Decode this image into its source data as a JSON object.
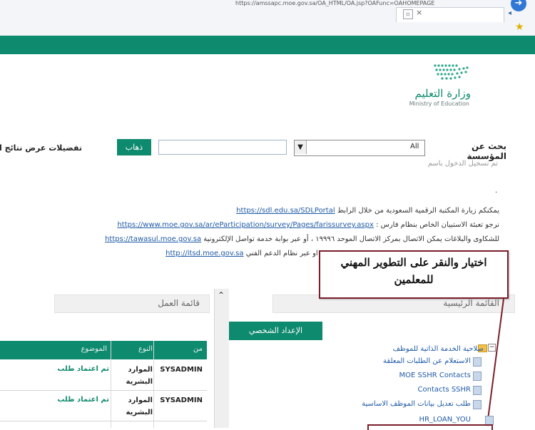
{
  "browser": {
    "url": "https://amssapc.moe.gov.sa/OA_HTML/OA.jsp?OAFunc=OAHOMEPAGE",
    "tab_close": "×"
  },
  "header": {
    "logo_arabic": "وزارة التعليم",
    "logo_english": "Ministry of Education"
  },
  "search": {
    "label": "بحث عن المؤسسة",
    "select_value": "All",
    "go_button": "ذهاب",
    "preferences_label": "تفضيلات عرض نتائج ا",
    "login_as": "تم تسجيل الدخول باسم"
  },
  "info": {
    "dot": ".",
    "line1_text": "يمكنكم زيارة المكتبة الرقمية السعودية من خلال الرابط",
    "line1_link": "https://sdl.edu.sa/SDLPortal",
    "line2_text": "نرجو تعبئة الاستبيان الخاص بنظام فارس :",
    "line2_link": "https://www.moe.gov.sa/ar/eParticipation/survey/Pages/farissurvey.aspx",
    "line3_text": "للشكاوى والبلاغات يمكن الاتصال بمركز الاتصال الموحد ١٩٩٩٦ ، أو عبر بوابة خدمة تواصل الإلكترونية",
    "line3_link": "https://tawasul.moe.gov.sa",
    "line4_text": "٨٨٨ او عبر نظام الدعم الفني",
    "line4_link": "http://itsd.moe.gov.sa"
  },
  "annotation": {
    "text": "اختيار والنقر على التطوير المهني للمعلمين"
  },
  "main_menu": {
    "title": "القائمة الرئيسية",
    "profile_button": "الإعداد الشخصي",
    "tree": [
      "صلاحية الخدمة الذاتية للموظف",
      "الاستعلام عن الطلبات المعلقة",
      "MOE SSHR Contacts",
      "Contacts SSHR",
      "طلب تعديل بيانات الموظف الاساسية",
      "HR_LOAN_YOU"
    ]
  },
  "worklist": {
    "title": "قائمة العمل",
    "columns": [
      "من",
      "النوع",
      "الموضوع"
    ],
    "rows": [
      {
        "from": "SYSADMIN",
        "type": "الموارد البشرية",
        "subject": "تم اعتماد طلب"
      },
      {
        "from": "SYSADMIN",
        "type": "الموارد البشرية",
        "subject": "تم اعتماد طلب"
      }
    ]
  },
  "colors": {
    "brand_green": "#0e8a6e",
    "link_blue": "#1f5aa6",
    "annotation_border": "#7a1e2a"
  }
}
